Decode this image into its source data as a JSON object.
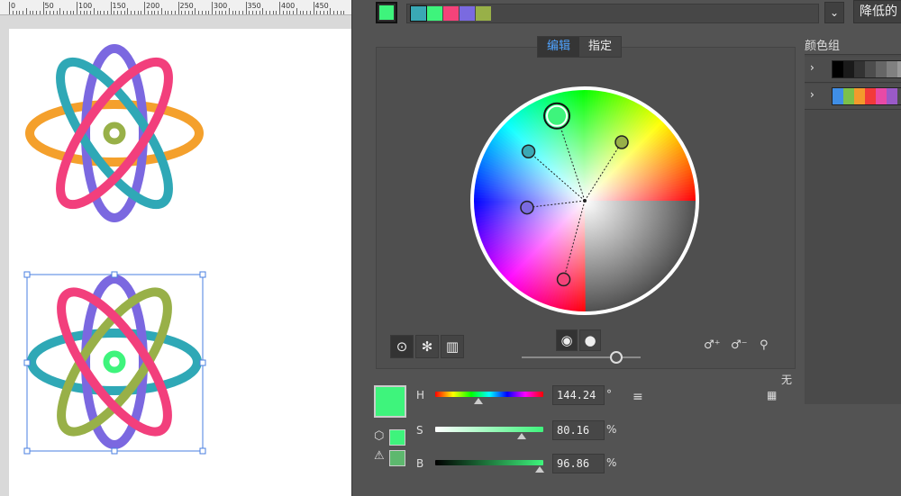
{
  "ruler": {
    "ticks": [
      "0",
      "50",
      "100",
      "150",
      "200",
      "250",
      "300",
      "350",
      "400",
      "450"
    ]
  },
  "panel": {
    "active_color": "#3ef47c",
    "harmony_colors": [
      "#3aa9b5",
      "#3ef47c",
      "#f4437a",
      "#7a6ae0",
      "#98b048"
    ],
    "reduce_button": "降低的",
    "tabs": {
      "edit": "编辑",
      "assign": "指定"
    },
    "color_group_title": "颜色组",
    "groups": [
      {
        "colors": [
          "#000000",
          "#1a1a1a",
          "#333333",
          "#4d4d4d",
          "#666666",
          "#808080",
          "#999999"
        ]
      },
      {
        "colors": [
          "#3f8ee6",
          "#7cc04a",
          "#f39a2c",
          "#f23a3a",
          "#e84aa6",
          "#9a5ac8"
        ]
      }
    ],
    "none_label": "无"
  },
  "channels": [
    {
      "letter": "H",
      "value": "144.24",
      "unit": "°",
      "thumb_pct": 0.4
    },
    {
      "letter": "S",
      "value": "80.16",
      "unit": "%",
      "thumb_pct": 0.8
    },
    {
      "letter": "B",
      "value": "96.86",
      "unit": "%",
      "thumb_pct": 0.97
    }
  ],
  "wheel_markers": [
    {
      "role": "base",
      "color": "#3ef47c",
      "hue": 144.24,
      "sat": 0.8
    },
    {
      "color": "#98b048",
      "hue": 77,
      "sat": 0.62
    },
    {
      "color": "#3aa9b5",
      "hue": 185,
      "sat": 0.67
    },
    {
      "color": "#7a6ae0",
      "hue": 249,
      "sat": 0.52
    },
    {
      "color": "#f4437a",
      "hue": 340,
      "sat": 0.73
    }
  ],
  "artwork": {
    "atom1": {
      "colors": [
        "#f4a02c",
        "#2fa8b6",
        "#7b68e0",
        "#f23f7c",
        "#98b048"
      ]
    },
    "atom2": {
      "colors": [
        "#2fa8b6",
        "#7b68e0",
        "#f23f7c",
        "#98b048",
        "#3ef47c"
      ]
    }
  }
}
